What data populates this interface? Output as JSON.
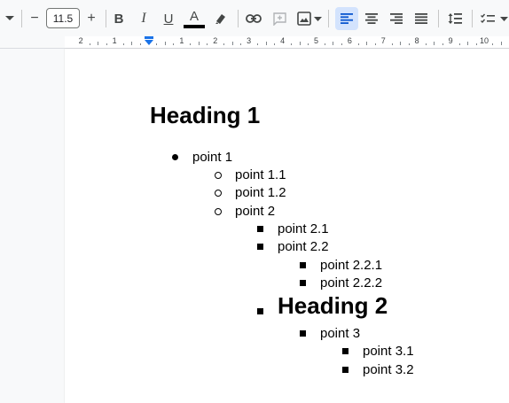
{
  "toolbar": {
    "font_size": "11.5",
    "minus_label": "−",
    "plus_label": "+",
    "bold_label": "B",
    "italic_label": "I",
    "underline_label": "U",
    "text_color_label": "A",
    "text_color": "#000000"
  },
  "ruler": {
    "numbers": [
      "2",
      "1",
      "1",
      "2",
      "3",
      "4",
      "5",
      "6",
      "7",
      "8",
      "9",
      "10"
    ]
  },
  "document": {
    "heading1": "Heading 1",
    "items": [
      {
        "label": "point 1",
        "level": 1
      },
      {
        "label": "point 1.1",
        "level": 2
      },
      {
        "label": "point 1.2",
        "level": 2
      },
      {
        "label": "point 2",
        "level": 2
      },
      {
        "label": "point 2.1",
        "level": 3
      },
      {
        "label": "point 2.2",
        "level": 3
      },
      {
        "label": "point 2.2.1",
        "level": 4
      },
      {
        "label": "point 2.2.2",
        "level": 4
      }
    ],
    "heading2": "Heading 2",
    "items2": [
      {
        "label": "point 3",
        "level": 4
      },
      {
        "label": "point 3.1",
        "level": 5
      },
      {
        "label": "point 3.2",
        "level": 5
      }
    ]
  }
}
